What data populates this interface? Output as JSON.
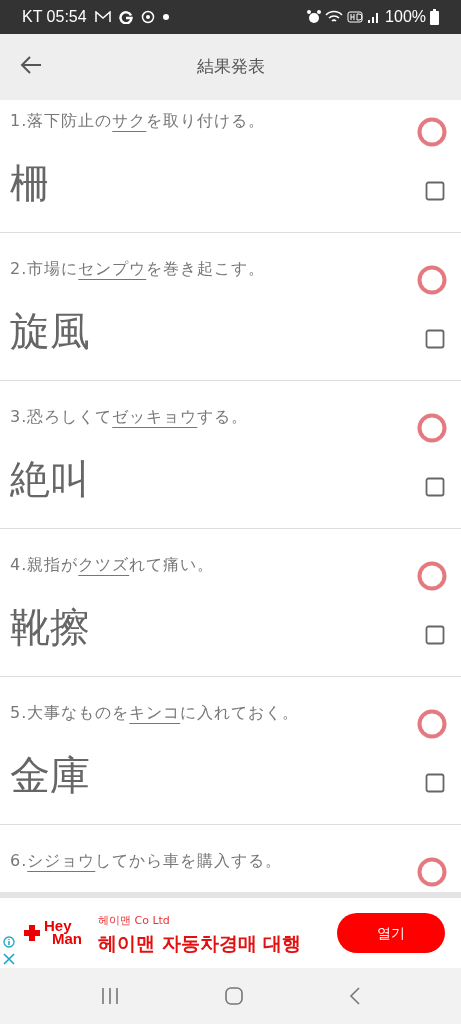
{
  "status_bar": {
    "left": "KT 05:54",
    "battery": "100%"
  },
  "header": {
    "title": "結果発表"
  },
  "questions": [
    {
      "number": "1.",
      "before": "落下防止の",
      "underlined": "サク",
      "after": "を取り付ける。",
      "answer": "柵",
      "correct": true,
      "checked": false
    },
    {
      "number": "2.",
      "before": "市場に",
      "underlined": "センプウ",
      "after": "を巻き起こす。",
      "answer": "旋風",
      "correct": true,
      "checked": false
    },
    {
      "number": "3.",
      "before": "恐ろしくて",
      "underlined": "ゼッキョウ",
      "after": "する。",
      "answer": "絶叫",
      "correct": true,
      "checked": false
    },
    {
      "number": "4.",
      "before": "親指が",
      "underlined": "クツズ",
      "after": "れて痛い。",
      "answer": "靴擦",
      "correct": true,
      "checked": false
    },
    {
      "number": "5.",
      "before": "大事なものを",
      "underlined": "キンコ",
      "after": "に入れておく。",
      "answer": "金庫",
      "correct": true,
      "checked": false
    },
    {
      "number": "6.",
      "underlined": "シジョウ",
      "after": "してから車を購入する。",
      "correct": true
    }
  ],
  "ad": {
    "logo_top": "Hey",
    "logo_bottom": "Man",
    "advertiser": "헤이맨 Co Ltd",
    "headline": "헤이맨 자동차경매 대행",
    "button": "열기"
  }
}
